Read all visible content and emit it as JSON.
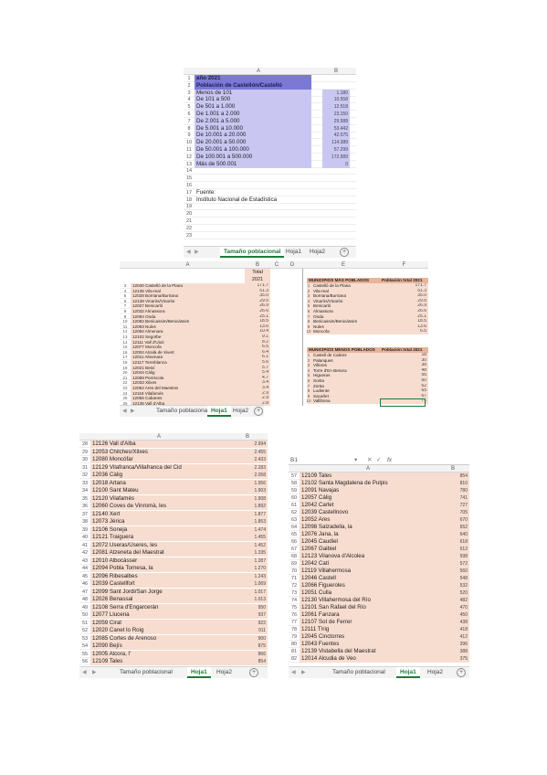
{
  "shot1": {
    "col_headers": [
      "A",
      "B"
    ],
    "rows": [
      {
        "n": "1",
        "a": "año 2021",
        "b": "",
        "style": "title"
      },
      {
        "n": "2",
        "a": "Población de Castellón/Castelló",
        "b": "",
        "style": "title"
      },
      {
        "n": "3",
        "a": "Menos de 101",
        "b": "1.180",
        "style": "lav"
      },
      {
        "n": "4",
        "a": "De 101 a 500",
        "b": "10.558",
        "style": "lav"
      },
      {
        "n": "5",
        "a": "De 501 a 1.000",
        "b": "12.518",
        "style": "lav"
      },
      {
        "n": "6",
        "a": "De 1.001 a 2.000",
        "b": "23.150",
        "style": "lav"
      },
      {
        "n": "7",
        "a": "De 2.001 a 5.000",
        "b": "29.588",
        "style": "lav"
      },
      {
        "n": "8",
        "a": "De 5.001 a 10.000",
        "b": "53.442",
        "style": "lav"
      },
      {
        "n": "9",
        "a": "De 10.001 a 20.000",
        "b": "42.575",
        "style": "lav"
      },
      {
        "n": "10",
        "a": "De 20.001 a 50.000",
        "b": "114.389",
        "style": "lav"
      },
      {
        "n": "11",
        "a": "De 50.001 a 100.000",
        "b": "57.299",
        "style": "lav"
      },
      {
        "n": "12",
        "a": "De 100.001 a 500.000",
        "b": "172.589",
        "style": "lav"
      },
      {
        "n": "13",
        "a": "Más de 500.001",
        "b": "0",
        "style": "lav"
      },
      {
        "n": "14",
        "a": "",
        "b": "",
        "style": ""
      },
      {
        "n": "15",
        "a": "",
        "b": "",
        "style": ""
      },
      {
        "n": "16",
        "a": "",
        "b": "",
        "style": ""
      },
      {
        "n": "17",
        "a": "Fuente:",
        "b": "",
        "style": ""
      },
      {
        "n": "18",
        "a": "Instituto Nacional de Estadística",
        "b": "",
        "style": ""
      },
      {
        "n": "19",
        "a": "",
        "b": "",
        "style": ""
      },
      {
        "n": "20",
        "a": "",
        "b": "",
        "style": ""
      },
      {
        "n": "21",
        "a": "",
        "b": "",
        "style": ""
      },
      {
        "n": "22",
        "a": "",
        "b": "",
        "style": ""
      },
      {
        "n": "23",
        "a": "",
        "b": "",
        "style": ""
      }
    ],
    "tabs": [
      "Tamaño poblacional",
      "Hoja1",
      "Hoja2"
    ],
    "active_tab": 0
  },
  "shot2": {
    "col_headers": [
      "A",
      "B",
      "C",
      "D",
      "E",
      "F"
    ],
    "header_b": "Total",
    "header_b2": "2021",
    "left_rows": [
      {
        "n": "3",
        "a": "12040 Castelló de la Plana",
        "b": "171.7"
      },
      {
        "n": "4",
        "a": "12135 Vila-real",
        "b": "51.3"
      },
      {
        "n": "5",
        "a": "12028 Borriana/Burriana",
        "b": "35.0"
      },
      {
        "n": "6",
        "a": "12138 Vinaròs/Vinaròs",
        "b": "29.5"
      },
      {
        "n": "7",
        "a": "12027 Benicarló",
        "b": "26.9"
      },
      {
        "n": "8",
        "a": "12032 Almassora",
        "b": "26.6"
      },
      {
        "n": "9",
        "a": "12084 Onda",
        "b": "25.1"
      },
      {
        "n": "10",
        "a": "12082 Benicassim/Benicàssim",
        "b": "18.5"
      },
      {
        "n": "11",
        "a": "12093 Nules",
        "b": "13.6"
      },
      {
        "n": "12",
        "a": "12094 Almenara",
        "b": "10.4"
      },
      {
        "n": "13",
        "a": "12102 Segorbe",
        "b": "9.1"
      },
      {
        "n": "14",
        "a": "12111 Vall d'Uixó",
        "b": "8.2"
      },
      {
        "n": "15",
        "a": "12077 Moncofa",
        "b": "6.5"
      },
      {
        "n": "16",
        "a": "12004 Alcalà de Xivert",
        "b": "6.4"
      },
      {
        "n": "17",
        "a": "12011 Almenara",
        "b": "6.1"
      },
      {
        "n": "18",
        "a": "12117 Torreblanca",
        "b": "5.6"
      },
      {
        "n": "19",
        "a": "12021 Betxí",
        "b": "5.7"
      },
      {
        "n": "20",
        "a": "12044 Càlig",
        "b": "5.4"
      },
      {
        "n": "21",
        "a": "12089 Peníscola",
        "b": "4.7"
      },
      {
        "n": "22",
        "a": "12033 Xilxes",
        "b": "3.4"
      },
      {
        "n": "23",
        "a": "12052 Ares del Maestrat",
        "b": "3.4"
      },
      {
        "n": "24",
        "a": "12116 Vilafamés",
        "b": "2.9"
      },
      {
        "n": "25",
        "a": "12056 Cabanes",
        "b": "2.9"
      },
      {
        "n": "26",
        "a": "12135 Vall d'Alba",
        "b": "2.8"
      }
    ],
    "right_title1": "MUNICIPIOS MÁS POBLADOS",
    "right_title1_b": "Población total 2021",
    "right_rows1": [
      {
        "n": "1",
        "a": "Castelló de la Plana",
        "b": "171.7"
      },
      {
        "n": "2",
        "a": "Vila-real",
        "b": "51.3"
      },
      {
        "n": "3",
        "a": "Borriana/Burriana",
        "b": "35.0"
      },
      {
        "n": "4",
        "a": "Vinaròs/Vinaròs",
        "b": "29.5"
      },
      {
        "n": "5",
        "a": "Benicarló",
        "b": "26.9"
      },
      {
        "n": "6",
        "a": "Almassora",
        "b": "26.6"
      },
      {
        "n": "7",
        "a": "Onda",
        "b": "25.1"
      },
      {
        "n": "8",
        "a": "Benicassim/Benicàssim",
        "b": "18.5"
      },
      {
        "n": "9",
        "a": "Nules",
        "b": "13.6"
      },
      {
        "n": "10",
        "a": "Moncofa",
        "b": "6.5"
      }
    ],
    "right_title2": "MUNICIPIOS MENOS POBLADOS",
    "right_title2_b": "Población total 2021",
    "right_rows2": [
      {
        "n": "1",
        "a": "Castell de Cabres",
        "b": "18"
      },
      {
        "n": "2",
        "a": "Palanques",
        "b": "30"
      },
      {
        "n": "3",
        "a": "Villores",
        "b": "38"
      },
      {
        "n": "4",
        "a": "Torre d'En Besora",
        "b": "48"
      },
      {
        "n": "5",
        "a": "Higueras",
        "b": "56"
      },
      {
        "n": "6",
        "a": "Sorita",
        "b": "60"
      },
      {
        "n": "7",
        "a": "Zorita",
        "b": "62"
      },
      {
        "n": "8",
        "a": "Ludiente",
        "b": "65"
      },
      {
        "n": "9",
        "a": "Sacañet",
        "b": "67"
      },
      {
        "n": "10",
        "a": "Vallibona",
        "b": "71"
      }
    ],
    "tabs": [
      "Tamaño poblacional",
      "Hoja1",
      "Hoja2"
    ],
    "active_tab": 1
  },
  "shot3": {
    "col_headers": [
      "A",
      "B"
    ],
    "rows": [
      {
        "n": "28",
        "a": "12126 Vall d'Alba",
        "b": "2.994"
      },
      {
        "n": "29",
        "a": "12053 Chilches/Xilxes",
        "b": "2.455"
      },
      {
        "n": "30",
        "a": "12080 Moncófar",
        "b": "2.433"
      },
      {
        "n": "31",
        "a": "12129 Vilafranca/Villafranca del Cid",
        "b": "2.283"
      },
      {
        "n": "32",
        "a": "12036 Càlig",
        "b": "2.058"
      },
      {
        "n": "33",
        "a": "12018 Artana",
        "b": "1.956"
      },
      {
        "n": "34",
        "a": "12100 Sant Mateu",
        "b": "1.903"
      },
      {
        "n": "35",
        "a": "12120 Vilafamés",
        "b": "1.908"
      },
      {
        "n": "36",
        "a": "12060 Coves de Vinromà, les",
        "b": "1.892"
      },
      {
        "n": "37",
        "a": "12140 Xert",
        "b": "1.877"
      },
      {
        "n": "38",
        "a": "12073 Jérica",
        "b": "1.853"
      },
      {
        "n": "39",
        "a": "12106 Soneja",
        "b": "1.474"
      },
      {
        "n": "40",
        "a": "12121 Traiguera",
        "b": "1.455"
      },
      {
        "n": "41",
        "a": "12072 Useras/Useres, les",
        "b": "1.452"
      },
      {
        "n": "42",
        "a": "12081 Atzeneta del Maestrat",
        "b": "1.335"
      },
      {
        "n": "43",
        "a": "12010 Albocàsser",
        "b": "1.287"
      },
      {
        "n": "44",
        "a": "12094 Pobla Tornesa, la",
        "b": "1.270"
      },
      {
        "n": "45",
        "a": "12096 Ribesalbes",
        "b": "1.243"
      },
      {
        "n": "46",
        "a": "12039 Castellfort",
        "b": "1.069"
      },
      {
        "n": "47",
        "a": "12099 Sant Jordi/San Jorge",
        "b": "1.017"
      },
      {
        "n": "48",
        "a": "12026 Benassal",
        "b": "1.013"
      },
      {
        "n": "49",
        "a": "12108 Serra d'Engarcerán",
        "b": "950"
      },
      {
        "n": "50",
        "a": "12077 Llucena",
        "b": "937"
      },
      {
        "n": "51",
        "a": "12059 Cirat",
        "b": "922"
      },
      {
        "n": "52",
        "a": "12020 Canet lo Roig",
        "b": "911"
      },
      {
        "n": "53",
        "a": "12085 Cortes de Arenoso",
        "b": "900"
      },
      {
        "n": "54",
        "a": "12090 Bejís",
        "b": "875"
      },
      {
        "n": "55",
        "a": "12005 Alcora, l'",
        "b": "866"
      },
      {
        "n": "56",
        "a": "12109 Tales",
        "b": "854"
      }
    ],
    "tabs": [
      "Tamaño poblacional",
      "Hoja1",
      "Hoja2"
    ],
    "active_tab": 1
  },
  "shot4": {
    "name_box": "B1",
    "formula_text": "fx",
    "col_headers": [
      "A",
      "B"
    ],
    "rows": [
      {
        "n": "57",
        "a": "12109 Tales",
        "b": "854"
      },
      {
        "n": "58",
        "a": "12102 Santa Magdalena de Pulpis",
        "b": "810"
      },
      {
        "n": "59",
        "a": "12091 Navajas",
        "b": "780"
      },
      {
        "n": "60",
        "a": "12057 Cálig",
        "b": "741"
      },
      {
        "n": "61",
        "a": "12042 Carlet",
        "b": "727"
      },
      {
        "n": "62",
        "a": "12039 Castellnovo",
        "b": "705"
      },
      {
        "n": "63",
        "a": "12052 Ares",
        "b": "670"
      },
      {
        "n": "64",
        "a": "12098 Salzadella, la",
        "b": "652"
      },
      {
        "n": "65",
        "a": "12076 Jana, la",
        "b": "640"
      },
      {
        "n": "66",
        "a": "12045 Caudiel",
        "b": "618"
      },
      {
        "n": "67",
        "a": "12067 Gaibiel",
        "b": "612"
      },
      {
        "n": "68",
        "a": "12123 Vilanova d'Alcolea",
        "b": "598"
      },
      {
        "n": "69",
        "a": "12042 Catí",
        "b": "572"
      },
      {
        "n": "70",
        "a": "12119 Villahermosa",
        "b": "560"
      },
      {
        "n": "71",
        "a": "12046 Castell",
        "b": "548"
      },
      {
        "n": "72",
        "a": "12066 Figueroles",
        "b": "532"
      },
      {
        "n": "73",
        "a": "12051 Culla",
        "b": "520"
      },
      {
        "n": "74",
        "a": "12130 Villahermosa del Río",
        "b": "482"
      },
      {
        "n": "75",
        "a": "12101 San Rafael del Río",
        "b": "470"
      },
      {
        "n": "76",
        "a": "12061 Fanzara",
        "b": "450"
      },
      {
        "n": "77",
        "a": "12107 Sot de Ferrer",
        "b": "438"
      },
      {
        "n": "78",
        "a": "12111 Tírig",
        "b": "418"
      },
      {
        "n": "79",
        "a": "12045 Cinctorres",
        "b": "412"
      },
      {
        "n": "80",
        "a": "12043 Fuentes",
        "b": "396"
      },
      {
        "n": "81",
        "a": "12139 Vistabella del Maestrat",
        "b": "388"
      },
      {
        "n": "82",
        "a": "12014 Alcudia de Veo",
        "b": "375"
      }
    ],
    "tabs": [
      "Tamaño poblacional",
      "Hoja1",
      "Hoja2"
    ],
    "active_tab": 1
  },
  "colors": {
    "lavender": "#c9c7f2",
    "lavender_dark": "#7c78d6",
    "peach": "#f7ddd0",
    "peach_dark": "#e9b499",
    "tab_green": "#1f7a3a"
  },
  "icons": {
    "add_sheet": "+",
    "prev": "◀",
    "next": "▶",
    "more": "…"
  }
}
